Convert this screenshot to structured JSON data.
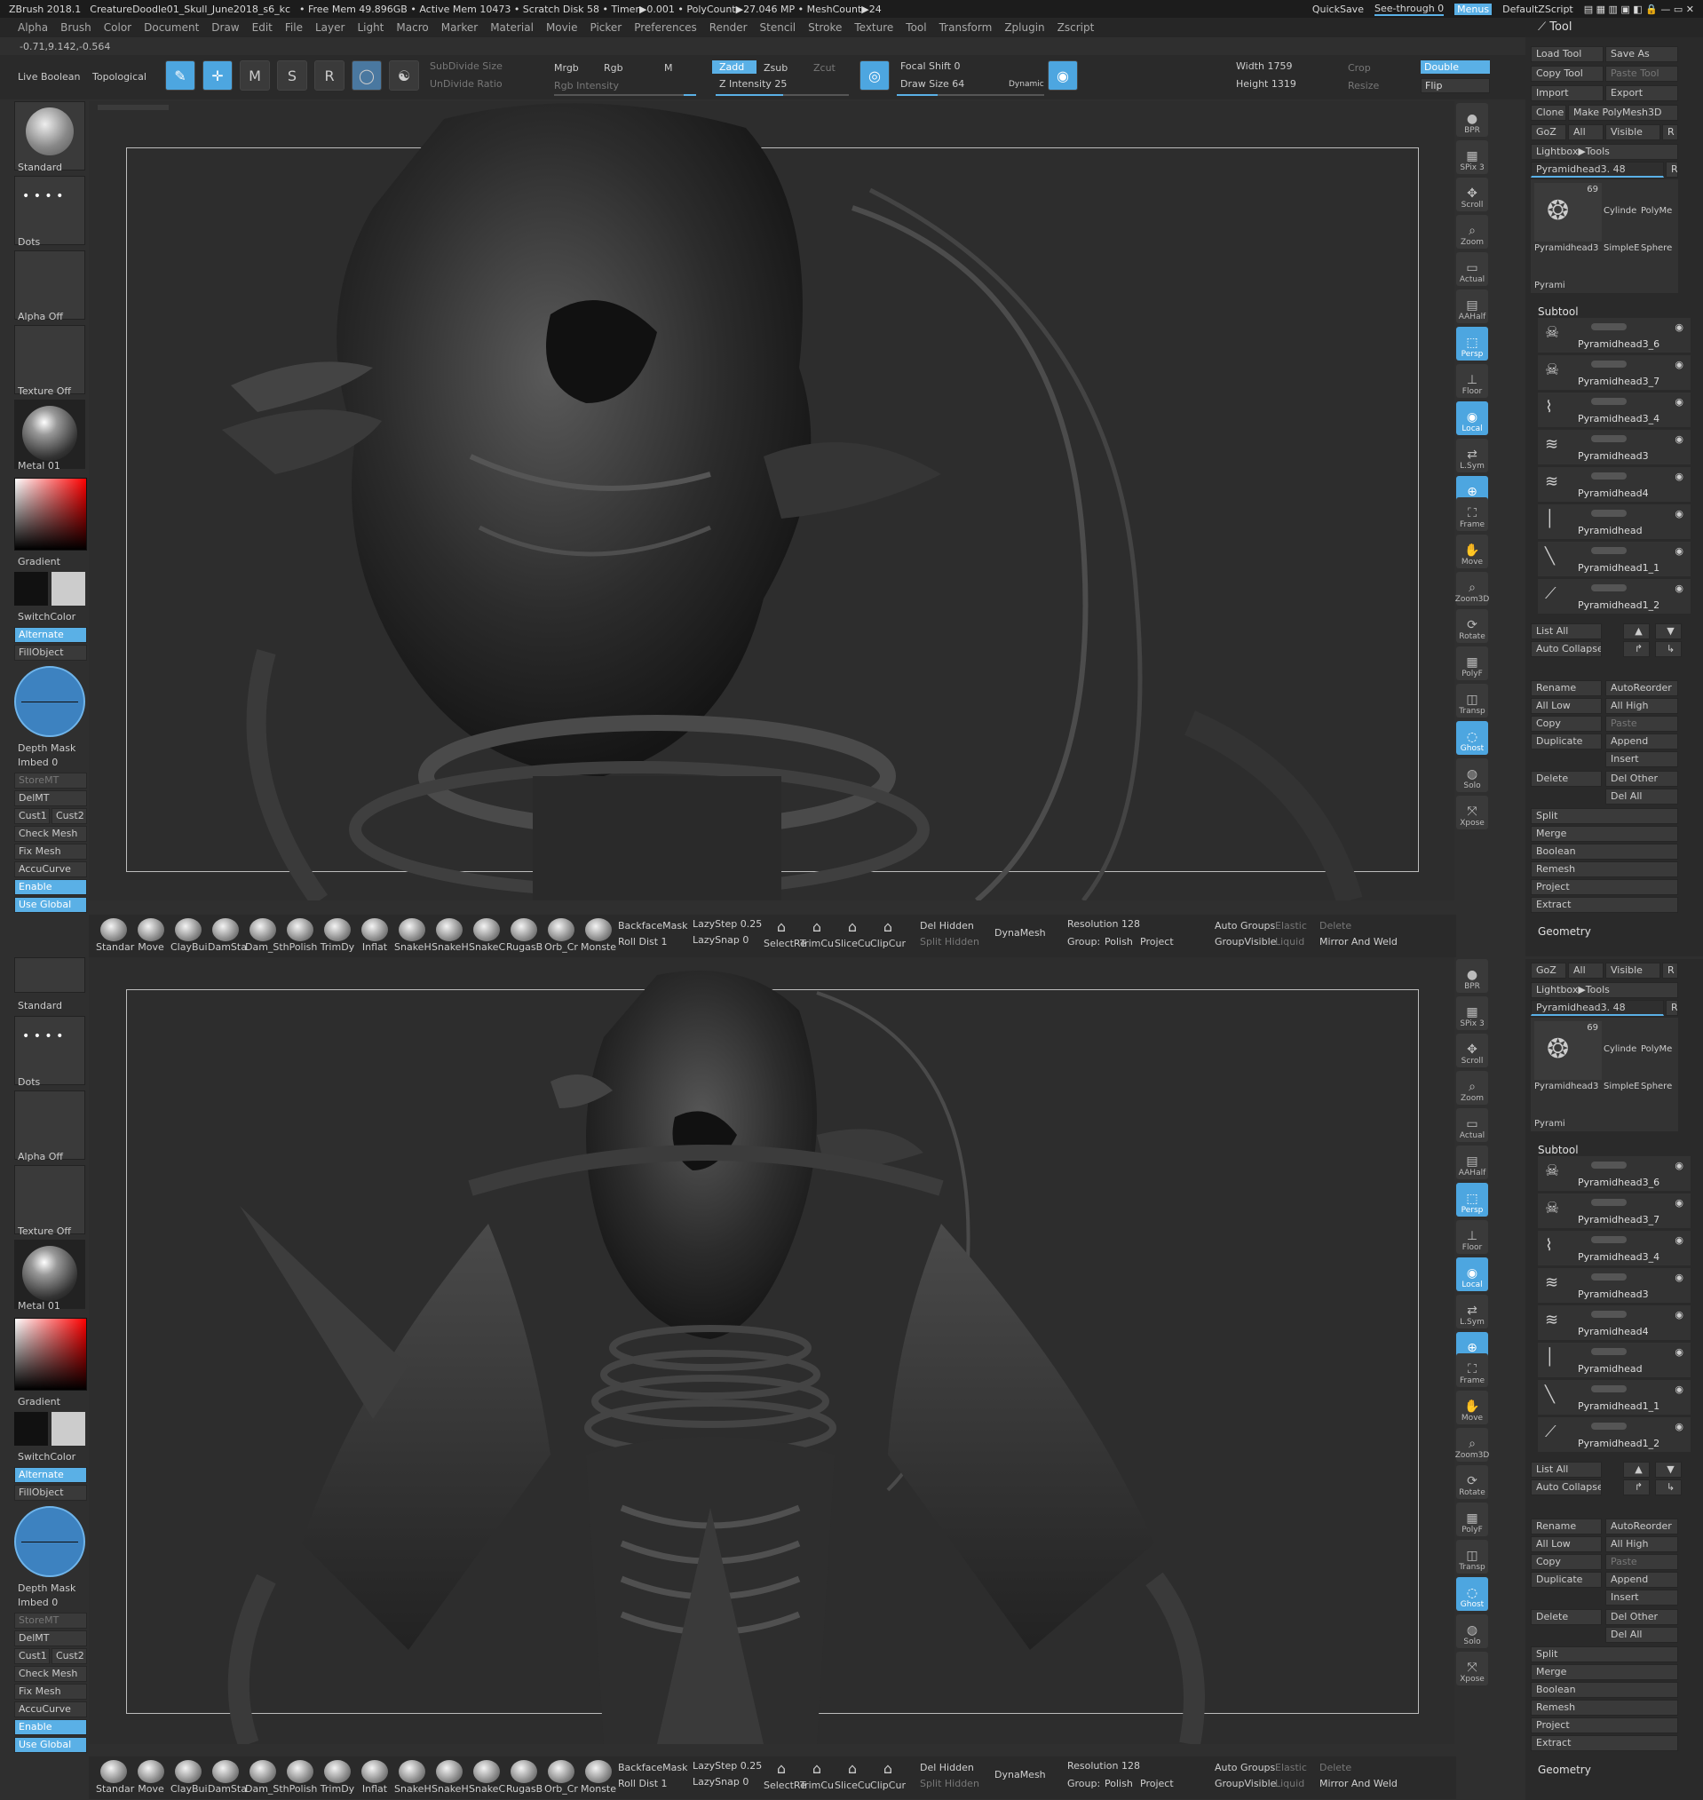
{
  "titlebar": {
    "app": "ZBrush 2018.1",
    "document": "CreatureDoodle01_Skull_June2018_s6_kc",
    "stats": "• Free Mem 49.896GB • Active Mem 10473 • Scratch Disk 58 • Timer▶0.001 • PolyCount▶27.046 MP • MeshCount▶24",
    "quicksave": "QuickSave",
    "see_through": "See-through  0",
    "menus": "Menus",
    "script": "DefaultZScript"
  },
  "menubar": [
    "Alpha",
    "Brush",
    "Color",
    "Document",
    "Draw",
    "Edit",
    "File",
    "Layer",
    "Light",
    "Macro",
    "Marker",
    "Material",
    "Movie",
    "Picker",
    "Preferences",
    "Render",
    "Stencil",
    "Stroke",
    "Texture",
    "Tool",
    "Transform",
    "Zplugin",
    "Zscript"
  ],
  "coords": "-0.71,9.142,-0.564",
  "tool_panel_title": "Tool",
  "shelf": {
    "live_boolean": "Live Boolean",
    "topological": "Topological",
    "edit": "Edit",
    "draw": "Draw",
    "move": "Move",
    "scale": "Scale",
    "rotate": "Rotate",
    "subdivide_size": "SubDivide Size",
    "undivide_ratio": "UnDivide Ratio",
    "mrgb": "Mrgb",
    "rgb": "Rgb",
    "m": "M",
    "rgb_intensity": "Rgb Intensity",
    "zadd": "Zadd",
    "zsub": "Zsub",
    "zcut": "Zcut",
    "z_intensity": "Z Intensity 25",
    "focal_shift": "Focal Shift 0",
    "draw_size": "Draw Size 64",
    "dynamic": "Dynamic",
    "width": "Width 1759",
    "height": "Height 1319",
    "crop": "Crop",
    "resize": "Resize",
    "double": "Double",
    "flip": "Flip"
  },
  "left": {
    "standard": "Standard",
    "dots": "Dots",
    "alpha_off": "Alpha Off",
    "texture_off": "Texture Off",
    "metal": "Metal 01",
    "gradient": "Gradient",
    "switchcolor": "SwitchColor",
    "alternate": "Alternate",
    "fillobject": "FillObject",
    "depth_mask": "Depth Mask",
    "imbed": "Imbed 0",
    "storemt": "StoreMT",
    "delmt": "DelMT",
    "cust1": "Cust1",
    "cust2": "Cust2",
    "check_mesh": "Check Mesh In",
    "fix_mesh": "Fix Mesh",
    "accucurve": "AccuCurve",
    "enable": "Enable",
    "use_global": "Use Global"
  },
  "nav": [
    "BPR",
    "SPix 3",
    "Scroll",
    "Zoom",
    "Actual",
    "AAHalf",
    "Persp",
    "Floor",
    "Local",
    "L.Sym",
    "Xyz",
    "Frame",
    "Move",
    "Zoom3D",
    "Rotate",
    "PolyF",
    "Transp",
    "Ghost",
    "Solo",
    "Xpose"
  ],
  "tool": {
    "load_tool": "Load Tool",
    "save_as": "Save As",
    "copy_tool": "Copy Tool",
    "paste_tool": "Paste Tool",
    "import": "Import",
    "export": "Export",
    "clone": "Clone",
    "make_polymesh": "Make PolyMesh3D",
    "goz": "GoZ",
    "all": "All",
    "visible": "Visible",
    "r": "R",
    "lightbox": "Lightbox▶Tools",
    "current": "Pyramidhead3. 48",
    "thumb_count": "69",
    "thumbs": [
      "Pyramidhead3",
      "Cylinde",
      "PolyMe",
      "SimpleE",
      "Sphere",
      "Pyrami"
    ],
    "subtool_title": "Subtool",
    "subtools": [
      "Pyramidhead3_6",
      "Pyramidhead3_7",
      "Pyramidhead3_4",
      "Pyramidhead3",
      "Pyramidhead4",
      "Pyramidhead",
      "Pyramidhead1_1",
      "Pyramidhead1_2"
    ],
    "list_all": "List All",
    "auto_collapse": "Auto Collapse",
    "rename": "Rename",
    "autoreorder": "AutoReorder",
    "all_low": "All Low",
    "all_high": "All High",
    "copy": "Copy",
    "paste": "Paste",
    "duplicate": "Duplicate",
    "append": "Append",
    "insert": "Insert",
    "delete": "Delete",
    "del_other": "Del Other",
    "del_all": "Del All",
    "split": "Split",
    "merge": "Merge",
    "boolean": "Boolean",
    "remesh": "Remesh",
    "project": "Project",
    "extract": "Extract",
    "geometry": "Geometry"
  },
  "brushbar": {
    "brushes": [
      "Standar",
      "Move",
      "ClayBui",
      "DamSta",
      "Dam_St",
      "hPolish",
      "TrimDy",
      "Inflat",
      "SnakeH",
      "SnakeH",
      "SnakeC",
      "RugasB",
      "Orb_Cr",
      "Monste"
    ],
    "backface": "BackfaceMask",
    "roll_dist": "Roll Dist 1",
    "lazystep": "LazyStep 0.25",
    "lazysnap": "LazySnap 0",
    "tools": [
      "SelectRe",
      "TrimCu",
      "SliceCu",
      "ClipCur"
    ],
    "del_hidden": "Del Hidden",
    "split_hidden": "Split Hidden",
    "dynamesh": "DynaMesh",
    "resolution": "Resolution 128",
    "group": "Group:",
    "polish": "Polish",
    "project": "Project",
    "auto_groups": "Auto Groups",
    "elastic": "Elastic",
    "delete": "Delete",
    "groupvisible": "GroupVisible",
    "liquid": "Liquid",
    "mirror_weld": "Mirror And Weld"
  },
  "colors": {
    "accent": "#5ab0e6",
    "panel": "#2a2a2a",
    "button": "#3a3a3a",
    "canvas": "#2d2d2d"
  }
}
